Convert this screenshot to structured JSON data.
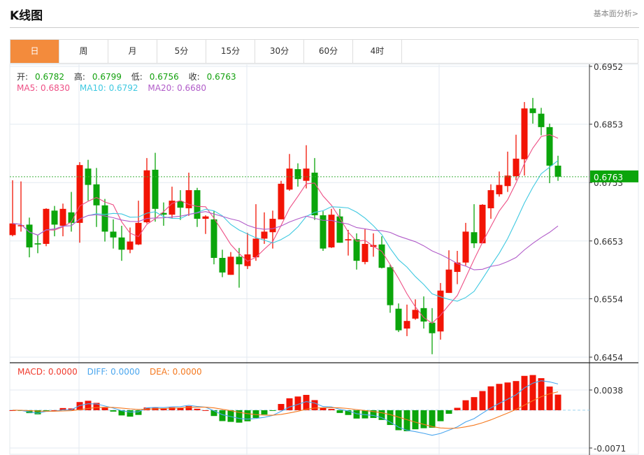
{
  "header": {
    "title": "K线图",
    "link": "基本面分析>"
  },
  "tabs": [
    {
      "label": "日",
      "active": true
    },
    {
      "label": "周"
    },
    {
      "label": "月"
    },
    {
      "label": "5分"
    },
    {
      "label": "15分"
    },
    {
      "label": "30分"
    },
    {
      "label": "60分"
    },
    {
      "label": "4时"
    }
  ],
  "ohlc_legend": {
    "open_label": "开:",
    "open": "0.6782",
    "high_label": "高:",
    "high": "0.6799",
    "low_label": "低:",
    "low": "0.6756",
    "close_label": "收:",
    "close": "0.6763"
  },
  "ma_legend": {
    "ma5": "MA5: 0.6830",
    "ma10": "MA10: 0.6792",
    "ma20": "MA20: 0.6680"
  },
  "macd_legend": {
    "macd": "MACD: 0.0000",
    "diff": "DIFF: 0.0000",
    "dea": "DEA: 0.0000"
  },
  "colors": {
    "up": "#f21405",
    "down": "#0ba50b",
    "ma5": "#ee4f85",
    "ma10": "#3fc9e1",
    "ma20": "#b15cc9",
    "diff": "#4aa6ee",
    "dea": "#f5791f",
    "active_tab": "#f38b3c"
  },
  "chart_data": [
    {
      "type": "candlestick",
      "ylim": [
        0.6454,
        0.6952
      ],
      "yticks": [
        "0.6952",
        "0.6853",
        "0.6753",
        "0.6653",
        "0.6554",
        "0.6454"
      ],
      "last_price": "0.6763",
      "ohlc": [
        [
          0.6663,
          0.6757,
          0.6661,
          0.6683
        ],
        [
          0.6679,
          0.6755,
          0.6669,
          0.668
        ],
        [
          0.6681,
          0.6693,
          0.6625,
          0.6642
        ],
        [
          0.6649,
          0.6663,
          0.6632,
          0.6647
        ],
        [
          0.6648,
          0.6709,
          0.6644,
          0.6708
        ],
        [
          0.6705,
          0.6713,
          0.6661,
          0.6681
        ],
        [
          0.6679,
          0.6717,
          0.6661,
          0.6708
        ],
        [
          0.6702,
          0.6737,
          0.6669,
          0.6684
        ],
        [
          0.6684,
          0.6788,
          0.665,
          0.6783
        ],
        [
          0.6777,
          0.6792,
          0.6722,
          0.6749
        ],
        [
          0.675,
          0.6778,
          0.6677,
          0.6714
        ],
        [
          0.6714,
          0.6725,
          0.6652,
          0.6669
        ],
        [
          0.6669,
          0.669,
          0.664,
          0.6659
        ],
        [
          0.6659,
          0.6679,
          0.6619,
          0.6638
        ],
        [
          0.6638,
          0.6676,
          0.6632,
          0.6652
        ],
        [
          0.6647,
          0.6722,
          0.6646,
          0.6684
        ],
        [
          0.6685,
          0.6795,
          0.6683,
          0.6774
        ],
        [
          0.6775,
          0.6804,
          0.6686,
          0.6708
        ],
        [
          0.6701,
          0.6719,
          0.6679,
          0.6698
        ],
        [
          0.6698,
          0.6746,
          0.6692,
          0.6722
        ],
        [
          0.6721,
          0.674,
          0.6689,
          0.671
        ],
        [
          0.6709,
          0.677,
          0.6696,
          0.674
        ],
        [
          0.674,
          0.6744,
          0.6677,
          0.6691
        ],
        [
          0.6691,
          0.6697,
          0.6665,
          0.6695
        ],
        [
          0.669,
          0.6704,
          0.6613,
          0.6624
        ],
        [
          0.6624,
          0.6638,
          0.6591,
          0.6599
        ],
        [
          0.6595,
          0.6634,
          0.6595,
          0.6626
        ],
        [
          0.6626,
          0.6641,
          0.6573,
          0.6613
        ],
        [
          0.661,
          0.6667,
          0.6605,
          0.663
        ],
        [
          0.6625,
          0.6716,
          0.6619,
          0.6657
        ],
        [
          0.6657,
          0.6702,
          0.6648,
          0.6669
        ],
        [
          0.6668,
          0.6705,
          0.664,
          0.6691
        ],
        [
          0.669,
          0.6756,
          0.669,
          0.6751
        ],
        [
          0.6741,
          0.6802,
          0.6739,
          0.6777
        ],
        [
          0.6776,
          0.6786,
          0.6746,
          0.6759
        ],
        [
          0.6756,
          0.6817,
          0.6743,
          0.6777
        ],
        [
          0.677,
          0.6795,
          0.6689,
          0.6697
        ],
        [
          0.6697,
          0.6704,
          0.6636,
          0.664
        ],
        [
          0.6642,
          0.6708,
          0.6641,
          0.6698
        ],
        [
          0.6695,
          0.6708,
          0.665,
          0.665
        ],
        [
          0.6654,
          0.6672,
          0.6628,
          0.6656
        ],
        [
          0.6656,
          0.6666,
          0.6604,
          0.6619
        ],
        [
          0.6617,
          0.6673,
          0.6613,
          0.6648
        ],
        [
          0.6643,
          0.6666,
          0.6626,
          0.6646
        ],
        [
          0.6647,
          0.6661,
          0.6606,
          0.6607
        ],
        [
          0.6608,
          0.6613,
          0.653,
          0.6543
        ],
        [
          0.6537,
          0.6546,
          0.6497,
          0.65
        ],
        [
          0.6503,
          0.6544,
          0.649,
          0.6516
        ],
        [
          0.652,
          0.6553,
          0.6518,
          0.6535
        ],
        [
          0.6538,
          0.6558,
          0.6503,
          0.6515
        ],
        [
          0.6513,
          0.6538,
          0.6459,
          0.6495
        ],
        [
          0.6498,
          0.6581,
          0.6484,
          0.6568
        ],
        [
          0.6564,
          0.6637,
          0.6564,
          0.6604
        ],
        [
          0.66,
          0.6636,
          0.6579,
          0.6616
        ],
        [
          0.6616,
          0.6684,
          0.6611,
          0.6669
        ],
        [
          0.6668,
          0.6716,
          0.6641,
          0.6649
        ],
        [
          0.6649,
          0.6716,
          0.6649,
          0.6715
        ],
        [
          0.6709,
          0.675,
          0.6691,
          0.674
        ],
        [
          0.6733,
          0.6772,
          0.6729,
          0.6749
        ],
        [
          0.6747,
          0.6806,
          0.6737,
          0.6765
        ],
        [
          0.6764,
          0.6835,
          0.6757,
          0.6794
        ],
        [
          0.6793,
          0.6891,
          0.6765,
          0.688
        ],
        [
          0.688,
          0.6898,
          0.6854,
          0.6872
        ],
        [
          0.6871,
          0.6881,
          0.6834,
          0.6848
        ],
        [
          0.6848,
          0.6854,
          0.6752,
          0.6782
        ],
        [
          0.6782,
          0.6799,
          0.6756,
          0.6763
        ]
      ],
      "ma_periods": [
        5,
        10,
        20
      ]
    },
    {
      "type": "macd",
      "ylim": [
        -0.0071,
        0.0038
      ],
      "yticks": [
        "0.0038",
        "-0.0071"
      ]
    }
  ]
}
